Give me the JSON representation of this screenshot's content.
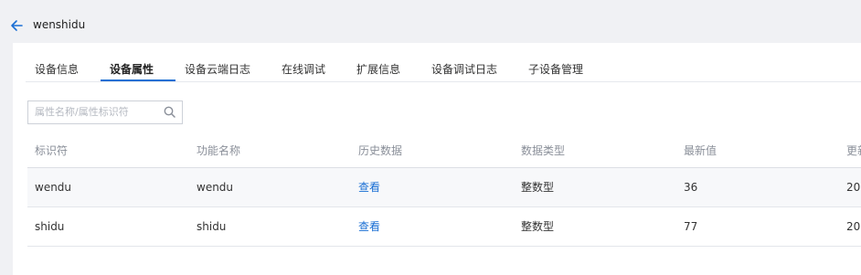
{
  "header": {
    "title": "wenshidu"
  },
  "tabs": [
    {
      "label": "设备信息"
    },
    {
      "label": "设备属性"
    },
    {
      "label": "设备云端日志"
    },
    {
      "label": "在线调试"
    },
    {
      "label": "扩展信息"
    },
    {
      "label": "设备调试日志"
    },
    {
      "label": "子设备管理"
    }
  ],
  "active_tab": "设备属性",
  "search": {
    "placeholder": "属性名称/属性标识符"
  },
  "table": {
    "columns": [
      "标识符",
      "功能名称",
      "历史数据",
      "数据类型",
      "最新值",
      "更新"
    ],
    "rows": [
      {
        "id": "wendu",
        "name": "wendu",
        "history": "查看",
        "type": "整数型",
        "value": "36",
        "updated": "20"
      },
      {
        "id": "shidu",
        "name": "shidu",
        "history": "查看",
        "type": "整数型",
        "value": "77",
        "updated": "20"
      }
    ]
  },
  "colors": {
    "accent": "#1a6fd4",
    "background": "#f0f1f4"
  }
}
